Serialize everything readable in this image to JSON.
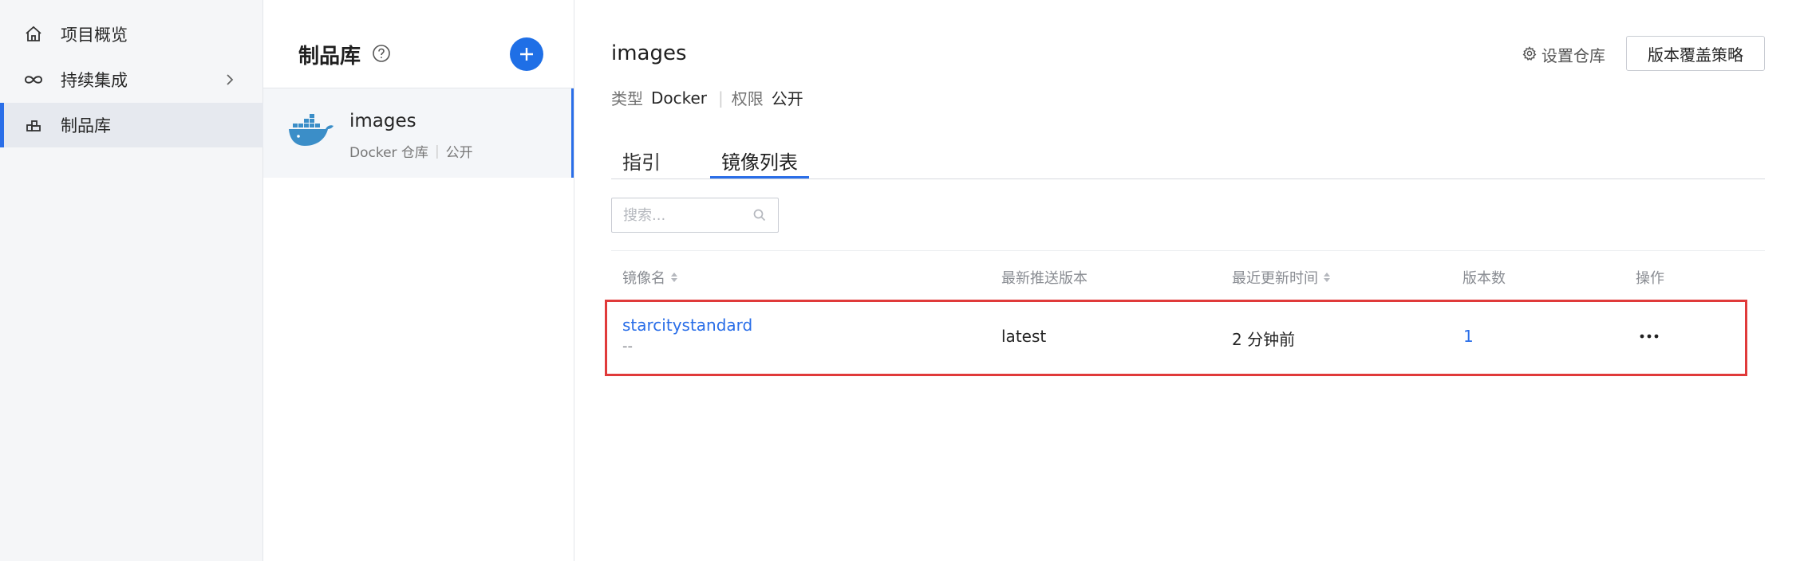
{
  "nav": {
    "items": [
      {
        "label": "项目概览",
        "icon": "home-icon"
      },
      {
        "label": "持续集成",
        "icon": "infinity-icon",
        "has_chevron": true
      },
      {
        "label": "制品库",
        "icon": "artifact-icon",
        "active": true
      }
    ]
  },
  "panel": {
    "title": "制品库",
    "repo": {
      "name": "images",
      "type_label": "Docker 仓库",
      "visibility": "公开"
    }
  },
  "main": {
    "repo_title": "images",
    "info": {
      "type_key": "类型",
      "type_value": "Docker",
      "perm_key": "权限",
      "perm_value": "公开"
    },
    "settings_label": "设置仓库",
    "policy_button": "版本覆盖策略",
    "tabs": [
      {
        "label": "指引",
        "active": false
      },
      {
        "label": "镜像列表",
        "active": true
      }
    ],
    "search": {
      "placeholder": "搜索...",
      "value": ""
    },
    "table": {
      "columns": [
        "镜像名",
        "最新推送版本",
        "最近更新时间",
        "版本数",
        "操作"
      ],
      "rows": [
        {
          "name": "starcitystandard",
          "desc": "--",
          "latest": "latest",
          "updated": "2 分钟前",
          "versions": "1"
        }
      ]
    }
  },
  "colors": {
    "accent": "#2a6ee8",
    "highlight_border": "#e03a3a",
    "nav_bg": "#f5f6f8"
  }
}
